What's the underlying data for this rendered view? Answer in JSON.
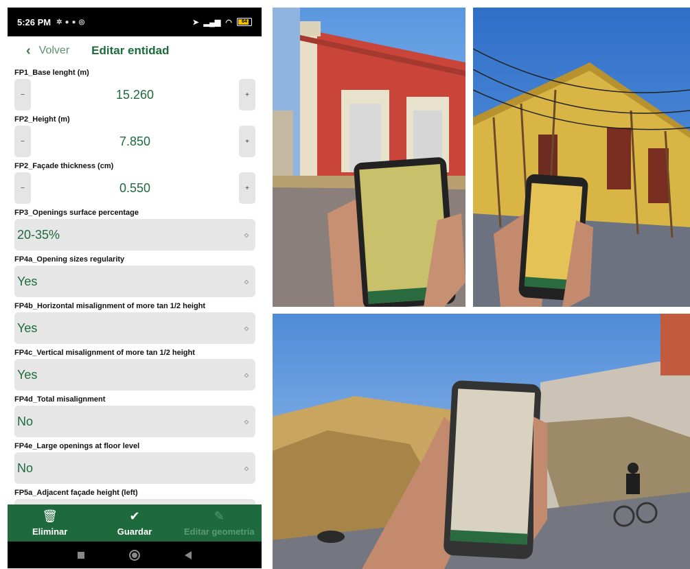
{
  "status_bar": {
    "time": "5:26 PM",
    "battery": "64"
  },
  "app_bar": {
    "back_label": "Volver",
    "title": "Editar entidad"
  },
  "fields": [
    {
      "label": "FP1_Base lenght (m)",
      "value": "15.260",
      "minus": "−",
      "plus": "+"
    },
    {
      "label": "FP2_Height (m)",
      "value": "7.850",
      "minus": "−",
      "plus": "+"
    },
    {
      "label": "FP2_Façade thickness (cm)",
      "value": "0.550",
      "minus": "−",
      "plus": "+"
    }
  ],
  "selects": [
    {
      "label": "FP3_Openings surface percentage",
      "value": "20-35%"
    },
    {
      "label": "FP4a_Opening sizes regularity",
      "value": "Yes"
    },
    {
      "label": "FP4b_Horizontal misalignment of more tan 1/2 height",
      "value": "Yes"
    },
    {
      "label": "FP4c_Vertical misalignment of more tan 1/2 height",
      "value": "Yes"
    },
    {
      "label": "FP4d_Total misalignment",
      "value": "No"
    },
    {
      "label": "FP4e_Large openings at floor level",
      "value": "No"
    }
  ],
  "partial_field": {
    "label": "FP5a_Adjacent façade height (left)"
  },
  "bottom_actions": {
    "delete_label": "Eliminar",
    "save_label": "Guardar",
    "edit_geometry_label": "Editar geometría"
  },
  "icons": {
    "back": "chevron-left-icon",
    "delete": "trash-icon",
    "save": "check-circle-icon",
    "edit": "pencil-icon"
  },
  "colors": {
    "accent_green": "#1f6a3d",
    "value_green": "#1e6a3e",
    "field_bg": "#e6e6e6"
  }
}
